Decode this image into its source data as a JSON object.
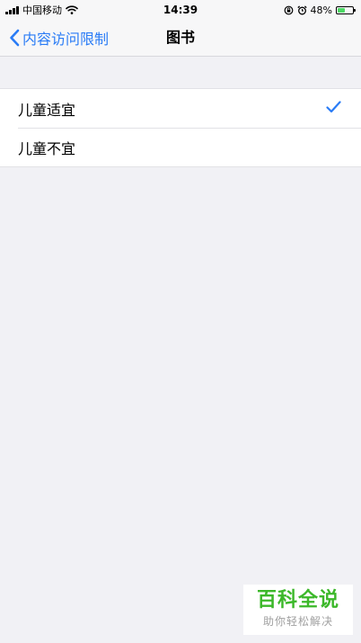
{
  "status_bar": {
    "carrier": "中国移动",
    "time": "14:39",
    "battery": "48%",
    "battery_level": 0.48,
    "icons": [
      "signal-icon",
      "wifi-icon",
      "orientation-lock-icon",
      "alarm-icon",
      "battery-icon"
    ]
  },
  "nav": {
    "back_label": "内容访问限制",
    "title": "图书"
  },
  "list": {
    "items": [
      {
        "label": "儿童适宜",
        "selected": true
      },
      {
        "label": "儿童不宜",
        "selected": false
      }
    ]
  },
  "watermark": {
    "title": "百科全说",
    "subtitle": "助你轻松解决"
  },
  "colors": {
    "accent": "#2a7cf6",
    "background": "#f1f1f5",
    "watermark_green": "#3cb82a",
    "battery_green": "#4cd964"
  }
}
